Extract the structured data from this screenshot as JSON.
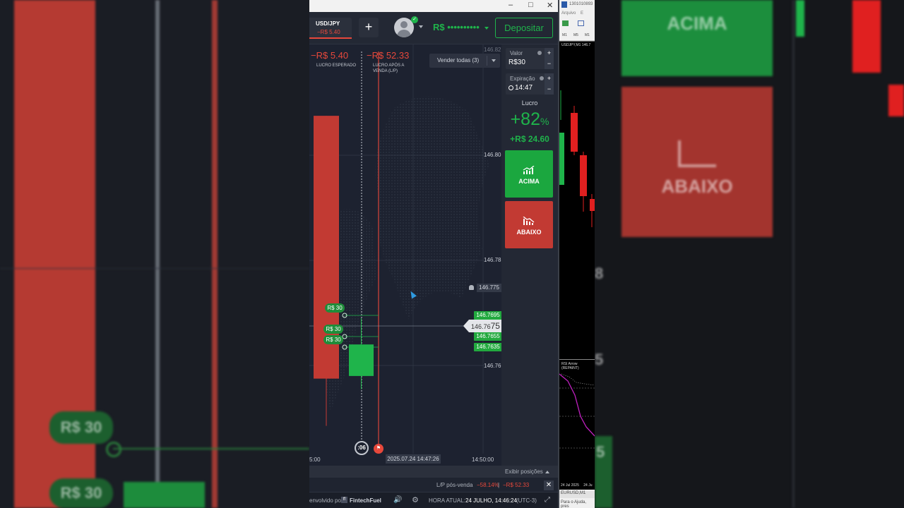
{
  "window": {
    "controls": [
      "–",
      "□",
      "✕"
    ]
  },
  "header": {
    "asset": "USD/JPY",
    "asset_pl": "−R$ 5.40",
    "add_label": "+",
    "balance": "R$ ••••••••••",
    "deposit_label": "Depositar"
  },
  "chart": {
    "expected_pl_value": "−R$ 5.40",
    "expected_pl_label": "LUCRO ESPERADO",
    "after_sale_value": "−R$ 52.33",
    "after_sale_label_1": "LUCRO APÓS A",
    "after_sale_label_2": "VENDA (L/P)",
    "sell_all_label": "Vender todas (3)",
    "price_levels": [
      "146.82",
      "146.80",
      "146.78",
      "146.76"
    ],
    "alert_price": "146.775",
    "current_price_main": "146.76",
    "current_price_tail": "75",
    "trade_tags": [
      "146.7695",
      "146.7655",
      "146.7635"
    ],
    "trade_amounts": [
      "R$ 30",
      "R$ 30",
      "R$ 30"
    ],
    "time_left": "5:00",
    "time_right": "14:50:00",
    "time_cursor": "2025.07.24 14:47:26",
    "timer": ":06",
    "candles": [
      {
        "color": "#c23a33",
        "open": 146.8075,
        "close": 146.7575,
        "high": 146.8075,
        "low": 146.7485
      },
      {
        "color": "#1fb44b",
        "open": 146.758,
        "close": 146.764,
        "high": 146.769,
        "low": 146.7555
      }
    ]
  },
  "panel": {
    "amount_label": "Valor",
    "amount_value": "R$30",
    "expiry_label": "Expiração",
    "expiry_value": "14:47",
    "profit_label": "Lucro",
    "profit_pct": "+82",
    "profit_pct_unit": "%",
    "profit_amount": "+R$ 24.60",
    "up_label": "ACIMA",
    "down_label": "ABAIXO",
    "plus": "+",
    "minus": "−"
  },
  "bottom": {
    "show_positions": "Exibir posições",
    "lp_label": "L/P pós-venda",
    "lp_pct": "−58.14%",
    "lp_sep": "|",
    "lp_value": "−R$ 52.33",
    "close": "✕",
    "developed_by": "envolvido por",
    "brand": "FintechFuel",
    "current_time_label": "HORA ATUAL:",
    "current_time_value": "24 JULHO, 14:46:24",
    "timezone": "(UTC-3)"
  },
  "mt4": {
    "title": "1301010893",
    "menu_file": "Arquivo",
    "menu_edit": "E",
    "tf_m1": "M1",
    "tf_m5": "M5",
    "tf_m15": "M1",
    "chart_title": "USDJPY,M1  146.7",
    "indicator_title": "RSI Arrow (REPAINT)",
    "date_1": "24 Jul 2025",
    "date_2": "24 Ju",
    "tab": "EURUSD,M1",
    "status": "Para o Ajuda, pres"
  },
  "background": {
    "left_amount_1": "R$ 30",
    "left_amount_2": "R$ 30",
    "right_up": "ACIMA",
    "right_down": "ABAIXO",
    "right_num_1": "8",
    "right_num_2": "5",
    "right_num_3": "5"
  },
  "colors": {
    "green": "#1fb44b",
    "red": "#e7483b",
    "bg": "#1d2230"
  }
}
